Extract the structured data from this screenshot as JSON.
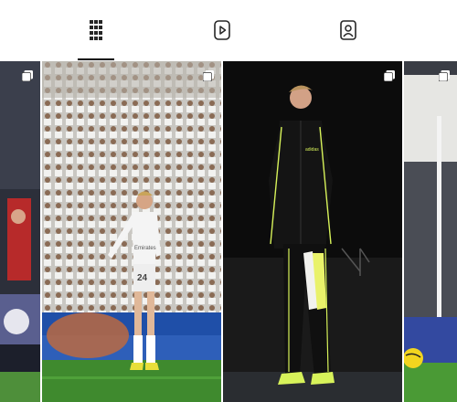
{
  "tabs": [
    {
      "name": "posts",
      "icon": "grid-icon",
      "active": true
    },
    {
      "name": "reels",
      "icon": "reels-play-icon",
      "active": false
    },
    {
      "name": "tagged",
      "icon": "tagged-user-icon",
      "active": false
    }
  ],
  "posts": [
    {
      "kind": "carousel",
      "icon": "multiple-photos-icon"
    },
    {
      "kind": "carousel",
      "icon": "multiple-photos-icon",
      "jersey_sponsor": "Emirates",
      "jersey_number": "24"
    },
    {
      "kind": "carousel",
      "icon": "multiple-photos-icon",
      "jacket_brand": "adidas"
    },
    {
      "kind": "carousel",
      "icon": "multiple-photos-icon"
    }
  ],
  "colors": {
    "accent": "#000000",
    "icon": "#262626",
    "pitch": "#3f8a2e",
    "kit_stripe": "#d7f25a"
  }
}
